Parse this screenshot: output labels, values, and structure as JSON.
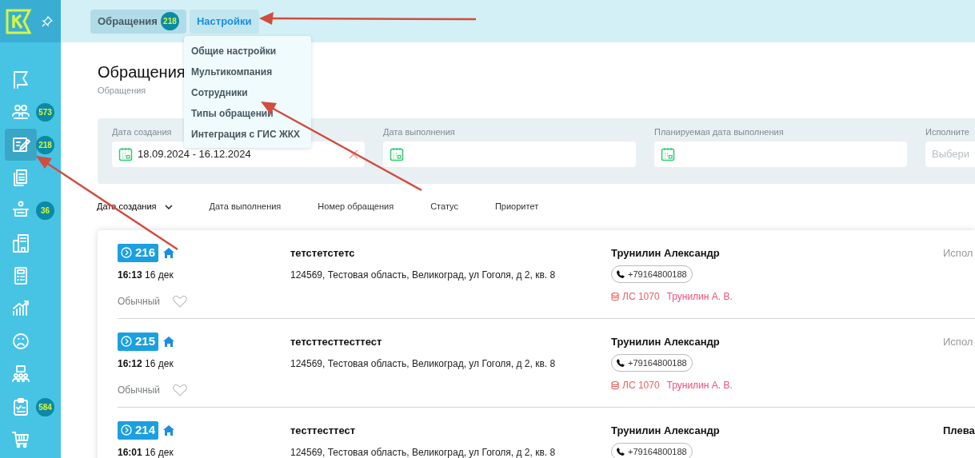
{
  "sidebar": {
    "items": [
      {
        "selected": false
      },
      {
        "selected": false,
        "badge": "573"
      },
      {
        "selected": true,
        "badge": "218"
      },
      {
        "selected": false
      },
      {
        "selected": false,
        "badge": "36"
      },
      {
        "selected": false
      },
      {
        "selected": false
      },
      {
        "selected": false
      },
      {
        "selected": false
      },
      {
        "selected": false
      },
      {
        "selected": false,
        "badge": "584"
      },
      {
        "selected": false
      }
    ]
  },
  "top_tabs": [
    {
      "label": "Обращения",
      "badge": "218",
      "selected": false
    },
    {
      "label": "Настройки",
      "selected": true
    }
  ],
  "settings_menu": {
    "items": [
      "Общие настройки",
      "Мультикомпания",
      "Сотрудники",
      "Типы обращений",
      "Интеграция с ГИС ЖКХ"
    ]
  },
  "page": {
    "title": "Обращения",
    "breadcrumb": "Обращения"
  },
  "filters": [
    {
      "kind": "date",
      "label": "Дата создания",
      "value": "18.09.2024 - 16.12.2024"
    },
    {
      "kind": "date",
      "label": "Дата выполнения"
    },
    {
      "kind": "date",
      "label": "Планируемая дата выполнения"
    },
    {
      "kind": "select",
      "label": "Исполните",
      "placeholder": "Выбери"
    }
  ],
  "sort_options": [
    {
      "label": "Дата создания",
      "selected": true
    },
    {
      "label": "Дата выполнения",
      "selected": false
    },
    {
      "label": "Номер обращения",
      "selected": false
    },
    {
      "label": "Статус",
      "selected": false
    },
    {
      "label": "Приоритет",
      "selected": false
    }
  ],
  "requests": [
    {
      "number": "216",
      "time": "16:13",
      "date": "16 дек",
      "priority": "Обычный",
      "favorite": false,
      "title": "тетстетстетс",
      "address": "124569, Тестовая область, Великоград, ул Гоголя, д 2, кв. 8",
      "name": "Трунилин Александр",
      "phone": "+79164800188",
      "account": "ЛС 1070",
      "account_holder": "Трунилин А. В.",
      "assignee": "Испол",
      "assignee_placeholder": true
    },
    {
      "number": "215",
      "time": "16:12",
      "date": "16 дек",
      "priority": "Обычный",
      "favorite": false,
      "title": "тетсттесттесттест",
      "address": "124569, Тестовая область, Великоград, ул Гоголя, д 2, кв. 8",
      "name": "Трунилин Александр",
      "phone": "+79164800188",
      "account": "ЛС 1070",
      "account_holder": "Трунилин А. В.",
      "assignee": "Испол",
      "assignee_placeholder": true
    },
    {
      "number": "214",
      "time": "16:01",
      "date": "16 дек",
      "title": "тесттесттест",
      "address": "124569, Тестовая область, Великоград, ул Гоголя, д 2, кв. 8",
      "name": "Трунилин Александр",
      "phone": "+79164800188",
      "assignee": "Плева",
      "assignee_placeholder": false
    }
  ]
}
